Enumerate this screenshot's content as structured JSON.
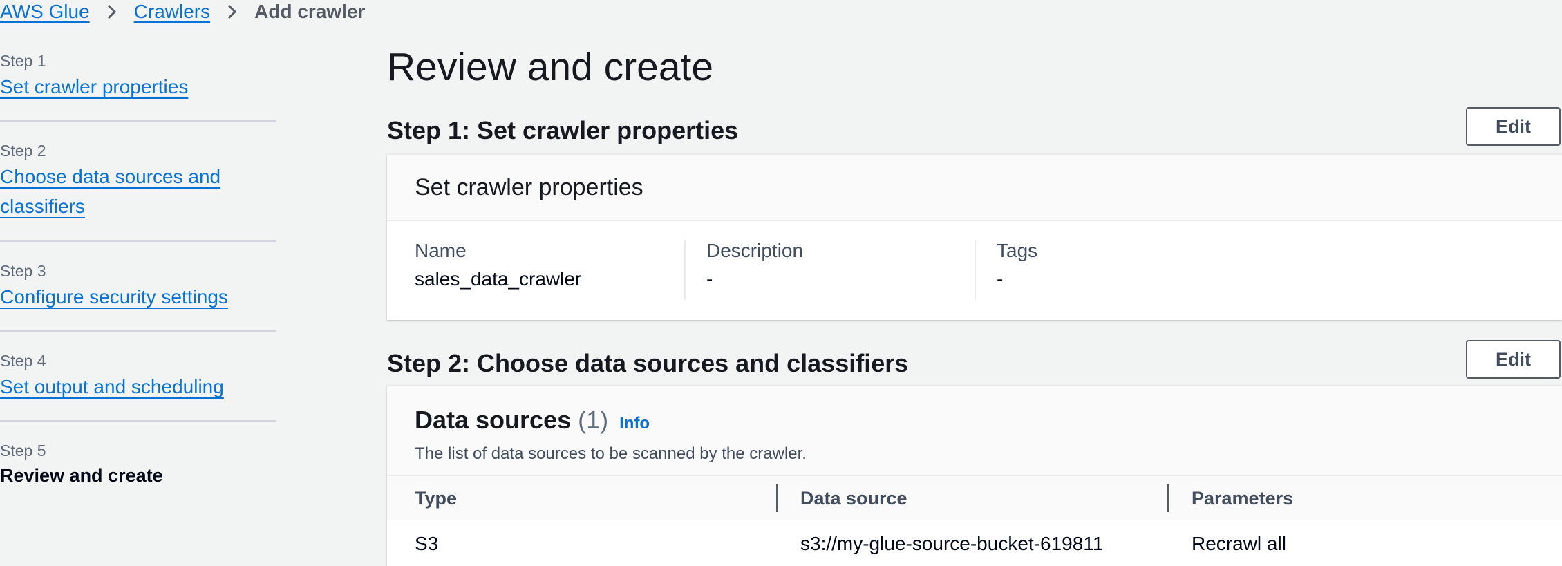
{
  "breadcrumb": {
    "items": [
      "AWS Glue",
      "Crawlers"
    ],
    "current": "Add crawler"
  },
  "steps": [
    {
      "number": "Step 1",
      "label": "Set crawler properties"
    },
    {
      "number": "Step 2",
      "label": "Choose data sources and classifiers"
    },
    {
      "number": "Step 3",
      "label": "Configure security settings"
    },
    {
      "number": "Step 4",
      "label": "Set output and scheduling"
    },
    {
      "number": "Step 5",
      "label": "Review and create"
    }
  ],
  "page_title": "Review and create",
  "section1": {
    "title": "Step 1: Set crawler properties",
    "edit_label": "Edit",
    "card_title": "Set crawler properties",
    "fields": [
      {
        "label": "Name",
        "value": "sales_data_crawler"
      },
      {
        "label": "Description",
        "value": "-"
      },
      {
        "label": "Tags",
        "value": "-"
      }
    ]
  },
  "section2": {
    "title": "Step 2: Choose data sources and classifiers",
    "edit_label": "Edit",
    "table_title": "Data sources",
    "table_count": "(1)",
    "info_label": "Info",
    "description": "The list of data sources to be scanned by the crawler.",
    "columns": [
      "Type",
      "Data source",
      "Parameters"
    ],
    "rows": [
      [
        "S3",
        "s3://my-glue-source-bucket-619811",
        "Recrawl all"
      ]
    ]
  },
  "colors": {
    "link": "#0972d3",
    "background": "#f2f3f3",
    "text": "#16191f"
  },
  "icons": {
    "breadcrumb_separator": "chevron-right-icon"
  }
}
